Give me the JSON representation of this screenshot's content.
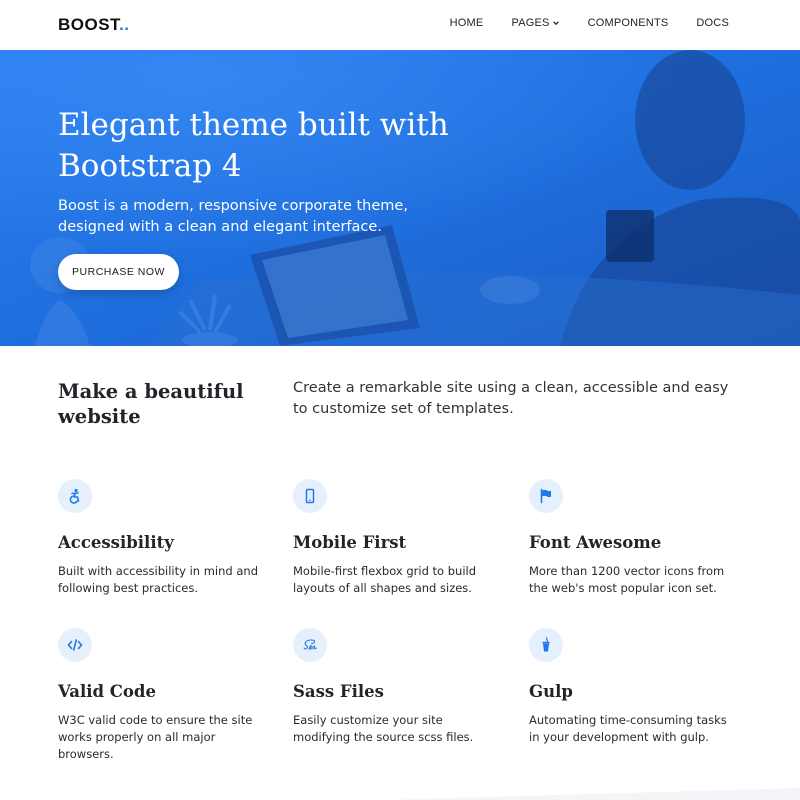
{
  "navbar": {
    "brand": "BOOST",
    "brand_dots": "..",
    "items": [
      {
        "label": "HOME"
      },
      {
        "label": "PAGES"
      },
      {
        "label": "COMPONENTS"
      },
      {
        "label": "DOCS"
      }
    ]
  },
  "hero": {
    "title": "Elegant theme built with Bootstrap 4",
    "subtitle": "Boost is a modern, responsive corporate theme, designed with a clean and elegant interface.",
    "button": "PURCHASE NOW"
  },
  "intro": {
    "title": "Make a beautiful website",
    "text": "Create a remarkable site using a clean, accessible and easy to customize set of templates."
  },
  "features": [
    {
      "icon": "accessibility-icon",
      "title": "Accessibility",
      "desc": "Built with accessibility in mind and following best practices."
    },
    {
      "icon": "mobile-icon",
      "title": "Mobile First",
      "desc": "Mobile-first flexbox grid to build layouts of all shapes and sizes."
    },
    {
      "icon": "flag-icon",
      "title": "Font Awesome",
      "desc": "More than 1200 vector icons from the web's most popular icon set."
    },
    {
      "icon": "code-icon",
      "title": "Valid Code",
      "desc": "W3C valid code to ensure the site works properly on all major browsers."
    },
    {
      "icon": "sass-icon",
      "title": "Sass Files",
      "desc": "Easily customize your site modifying the source scss files."
    },
    {
      "icon": "gulp-icon",
      "title": "Gulp",
      "desc": "Automating time-consuming tasks in your development with gulp."
    }
  ],
  "colors": {
    "accent": "#1f7ae8",
    "hero_overlay": "#1f6fdc",
    "icon_bg": "#e6f0fc"
  }
}
